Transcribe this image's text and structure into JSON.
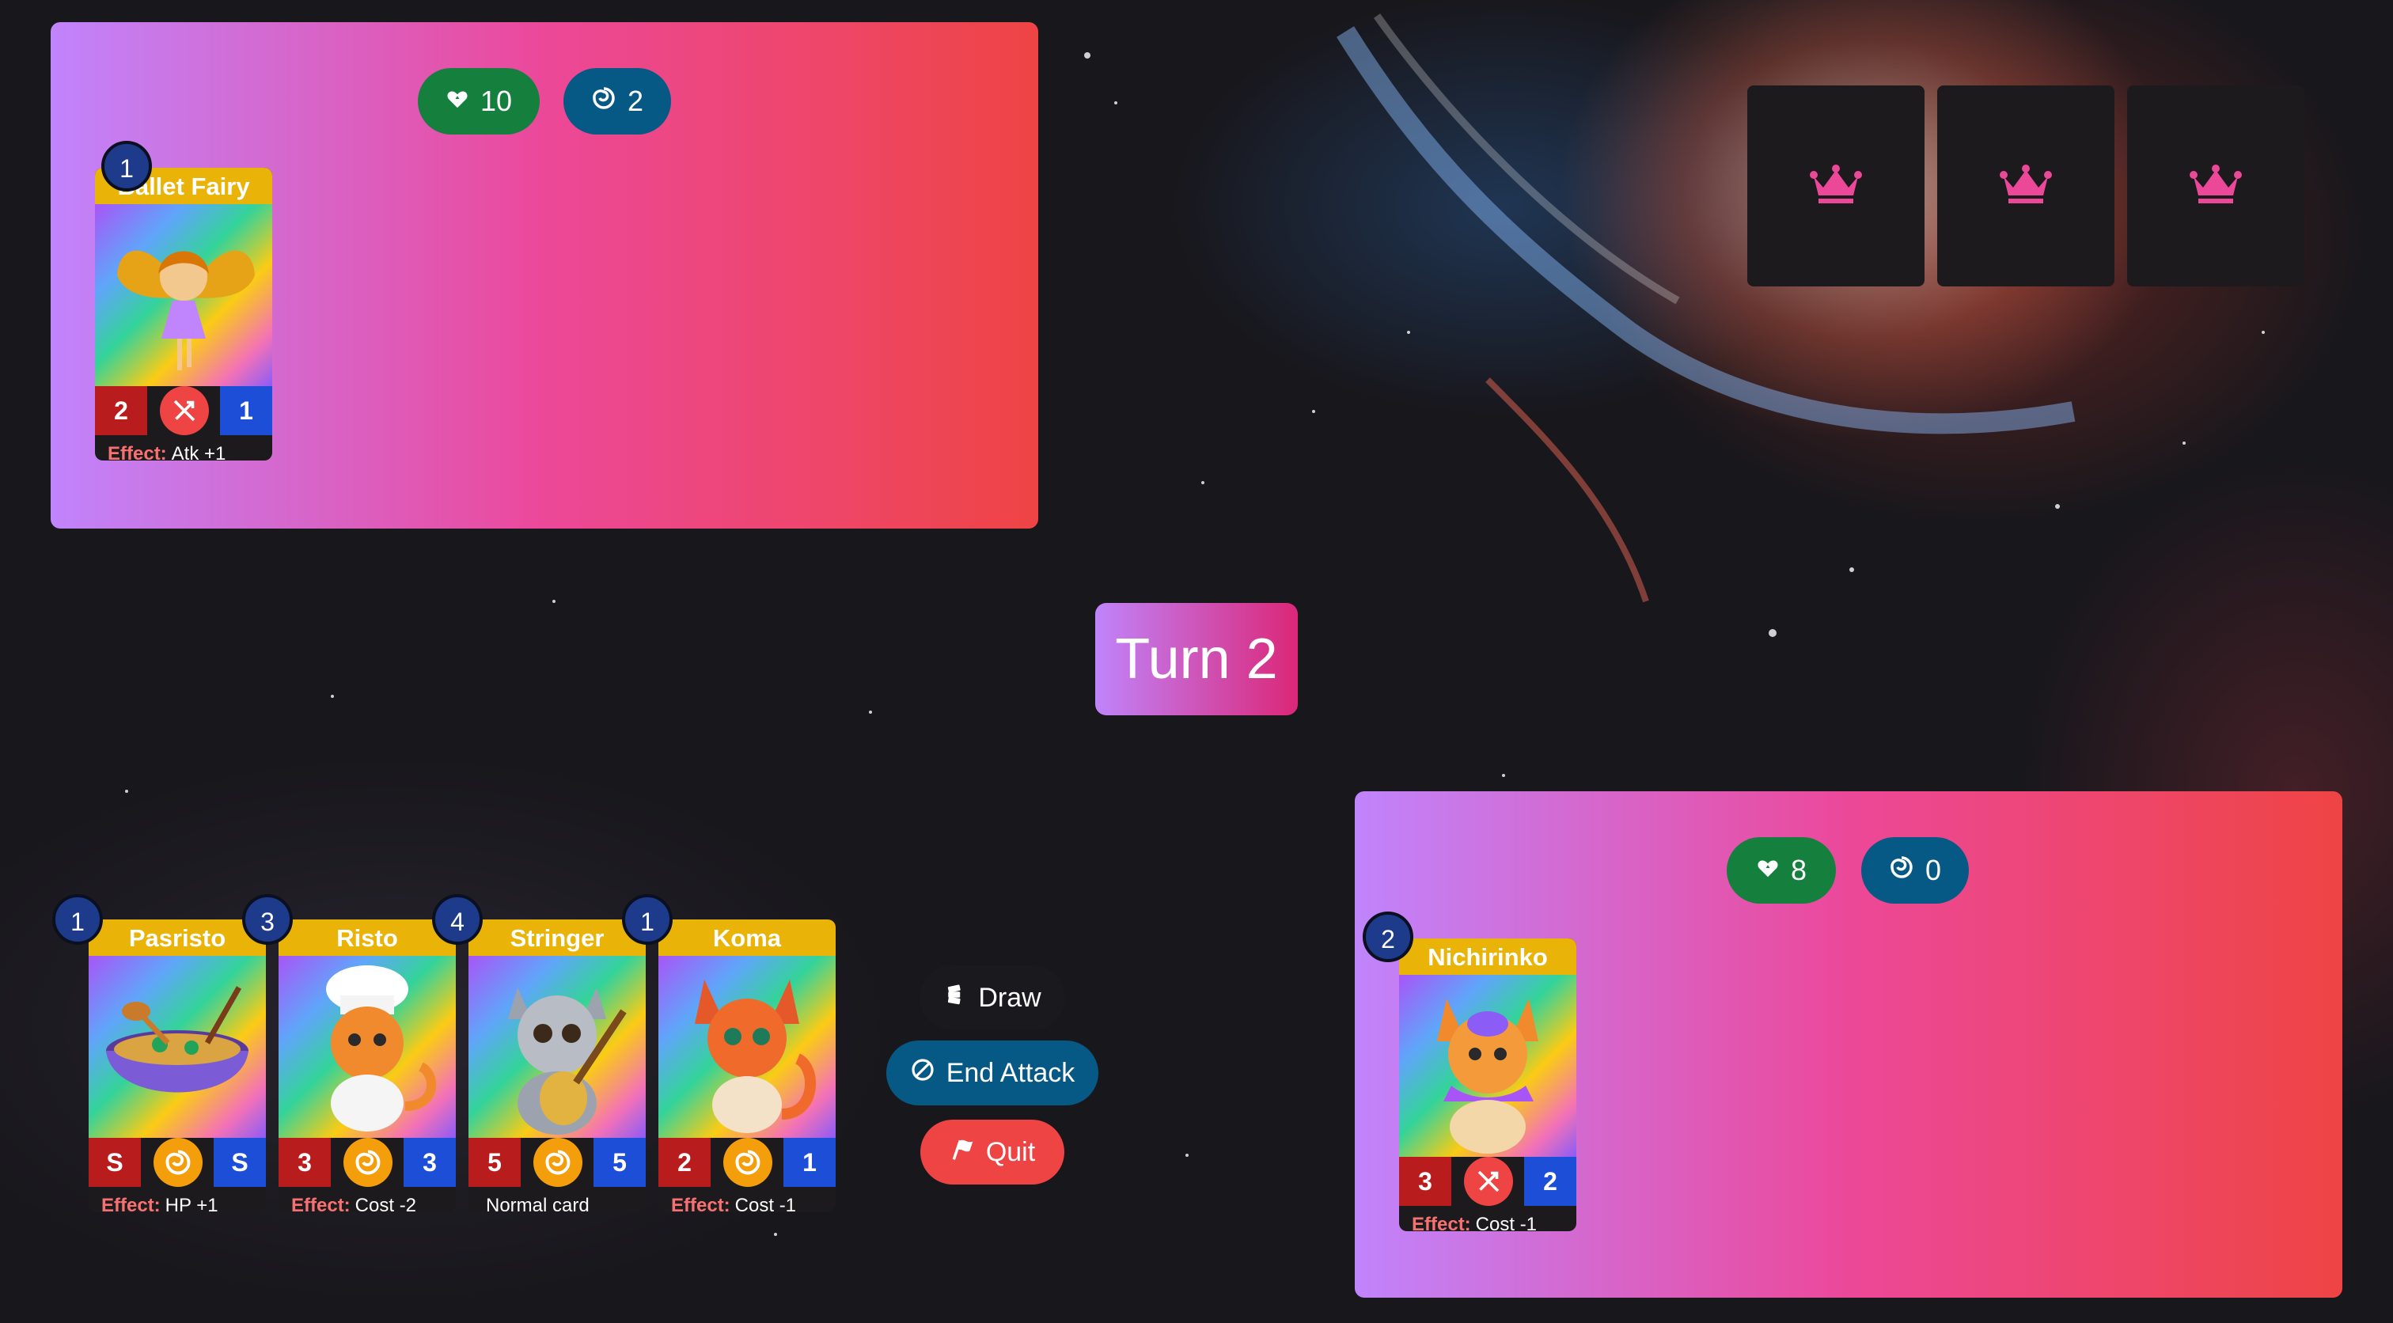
{
  "opponent": {
    "hp": "10",
    "mana": "2",
    "field": [
      {
        "name": "Ballet Fairy",
        "cost": "1",
        "atk": "2",
        "hp": "1",
        "type_icon": "no-attack-icon",
        "effect_label": "Effect:",
        "effect": "Atk +1"
      }
    ],
    "hand_back_icon": "crown-icon",
    "hand_count": 3
  },
  "turn": {
    "label": "Turn 2"
  },
  "player": {
    "hp": "8",
    "mana": "0",
    "field": [
      {
        "name": "Nichirinko",
        "cost": "2",
        "atk": "3",
        "hp": "2",
        "type_icon": "no-attack-icon",
        "effect_label": "Effect:",
        "effect": "Cost -1"
      }
    ],
    "hand": [
      {
        "name": "Pasristo",
        "cost": "1",
        "atk": "S",
        "hp": "S",
        "type_icon": "swirl-icon",
        "effect_label": "Effect:",
        "effect": "HP +1"
      },
      {
        "name": "Risto",
        "cost": "3",
        "atk": "3",
        "hp": "3",
        "type_icon": "swirl-icon",
        "effect_label": "Effect:",
        "effect": "Cost -2"
      },
      {
        "name": "Stringer",
        "cost": "4",
        "atk": "5",
        "hp": "5",
        "type_icon": "swirl-icon",
        "effect_label": "",
        "effect": "Normal card"
      },
      {
        "name": "Koma",
        "cost": "1",
        "atk": "2",
        "hp": "1",
        "type_icon": "swirl-icon",
        "effect_label": "Effect:",
        "effect": "Cost -1"
      }
    ]
  },
  "actions": {
    "draw": "Draw",
    "end_attack": "End Attack",
    "quit": "Quit"
  },
  "colors": {
    "hp_pill": "#15803d",
    "mana_pill": "#075985",
    "board_start": "#c084fc",
    "board_end": "#ef4444",
    "card_title": "#eab308",
    "atk": "#b91c1c",
    "hp_stat": "#1d4ed8",
    "crown": "#ec4899"
  }
}
